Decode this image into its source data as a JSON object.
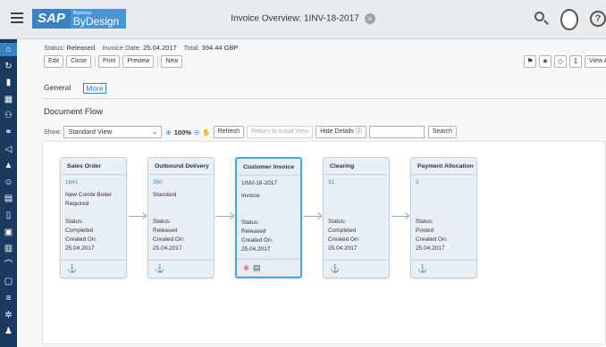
{
  "header": {
    "brand_sap": "SAP",
    "brand_business": "Business",
    "brand_product": "ByDesign",
    "title": "Invoice Overview: 1INV-18-2017",
    "close_glyph": "×"
  },
  "left_nav": {
    "items": [
      {
        "icon": "home-icon",
        "glyph": "⌂"
      },
      {
        "icon": "refresh-icon",
        "glyph": "↻"
      },
      {
        "icon": "bar-chart-icon",
        "glyph": "▮"
      },
      {
        "icon": "dashboard-icon",
        "glyph": "▦"
      },
      {
        "icon": "people-icon",
        "glyph": "⚇"
      },
      {
        "icon": "network-icon",
        "glyph": "⚭"
      },
      {
        "icon": "megaphone-icon",
        "glyph": "◁"
      },
      {
        "icon": "building-icon",
        "glyph": "▲"
      },
      {
        "icon": "person-icon",
        "glyph": "☺"
      },
      {
        "icon": "card-icon",
        "glyph": "▤"
      },
      {
        "icon": "document-icon",
        "glyph": "▯"
      },
      {
        "icon": "money-icon",
        "glyph": "▣"
      },
      {
        "icon": "ledger-icon",
        "glyph": "▥"
      },
      {
        "icon": "headset-icon",
        "glyph": "⌒"
      },
      {
        "icon": "clipboard-icon",
        "glyph": "▢"
      },
      {
        "icon": "list-icon",
        "glyph": "≡"
      },
      {
        "icon": "gear-people-icon",
        "glyph": "✲"
      },
      {
        "icon": "user-icon",
        "glyph": "♟"
      }
    ]
  },
  "status": {
    "status_label": "Status:",
    "status_value": "Released",
    "date_label": "Invoice Date:",
    "date_value": "25.04.2017",
    "total_label": "Total:",
    "total_value": "394.44 GBP"
  },
  "toolbar": {
    "edit": "Edit",
    "close": "Close",
    "print": "Print",
    "preview": "Preview",
    "new": "New",
    "view_all": "View All",
    "counter": "1"
  },
  "tabs": [
    {
      "label": "General",
      "selected": false
    },
    {
      "label": "More",
      "selected": true
    }
  ],
  "section_title": "Document Flow",
  "filter": {
    "show_label": "Show:",
    "view_value": "Standard View",
    "zoom_value": "100%",
    "refresh": "Refresh",
    "return_initial": "Return to Initial View",
    "hide_details": "Hide Details ⓘ",
    "search": "Search",
    "search_value": ""
  },
  "flow": {
    "cards": [
      {
        "title": "Sales Order",
        "doc": "1641",
        "lines": [
          "New Combi Boiler",
          "Required"
        ],
        "status_label": "Status:",
        "status": "Completed",
        "created_label": "Created On:",
        "created": "25.04.2017",
        "current": false
      },
      {
        "title": "Outbound Delivery",
        "doc": "350",
        "lines": [
          "Standard"
        ],
        "status_label": "Status:",
        "status": "Released",
        "created_label": "Created On:",
        "created": "25.04.2017",
        "current": false
      },
      {
        "title": "Customer Invoice",
        "doc": "1INV-18-2017",
        "lines": [
          "Invoice"
        ],
        "status_label": "Status:",
        "status": "Released",
        "created_label": "Created On:",
        "created": "25.04.2017",
        "current": true
      },
      {
        "title": "Clearing",
        "doc": "31",
        "lines": [],
        "status_label": "Status:",
        "status": "Completed",
        "created_label": "Created On:",
        "created": "25.04.2017",
        "current": false
      },
      {
        "title": "Payment Allocation",
        "doc": "5",
        "lines": [],
        "status_label": "Status:",
        "status": "Posted",
        "created_label": "Created On:",
        "created": "25.04.2017",
        "current": false
      }
    ]
  }
}
